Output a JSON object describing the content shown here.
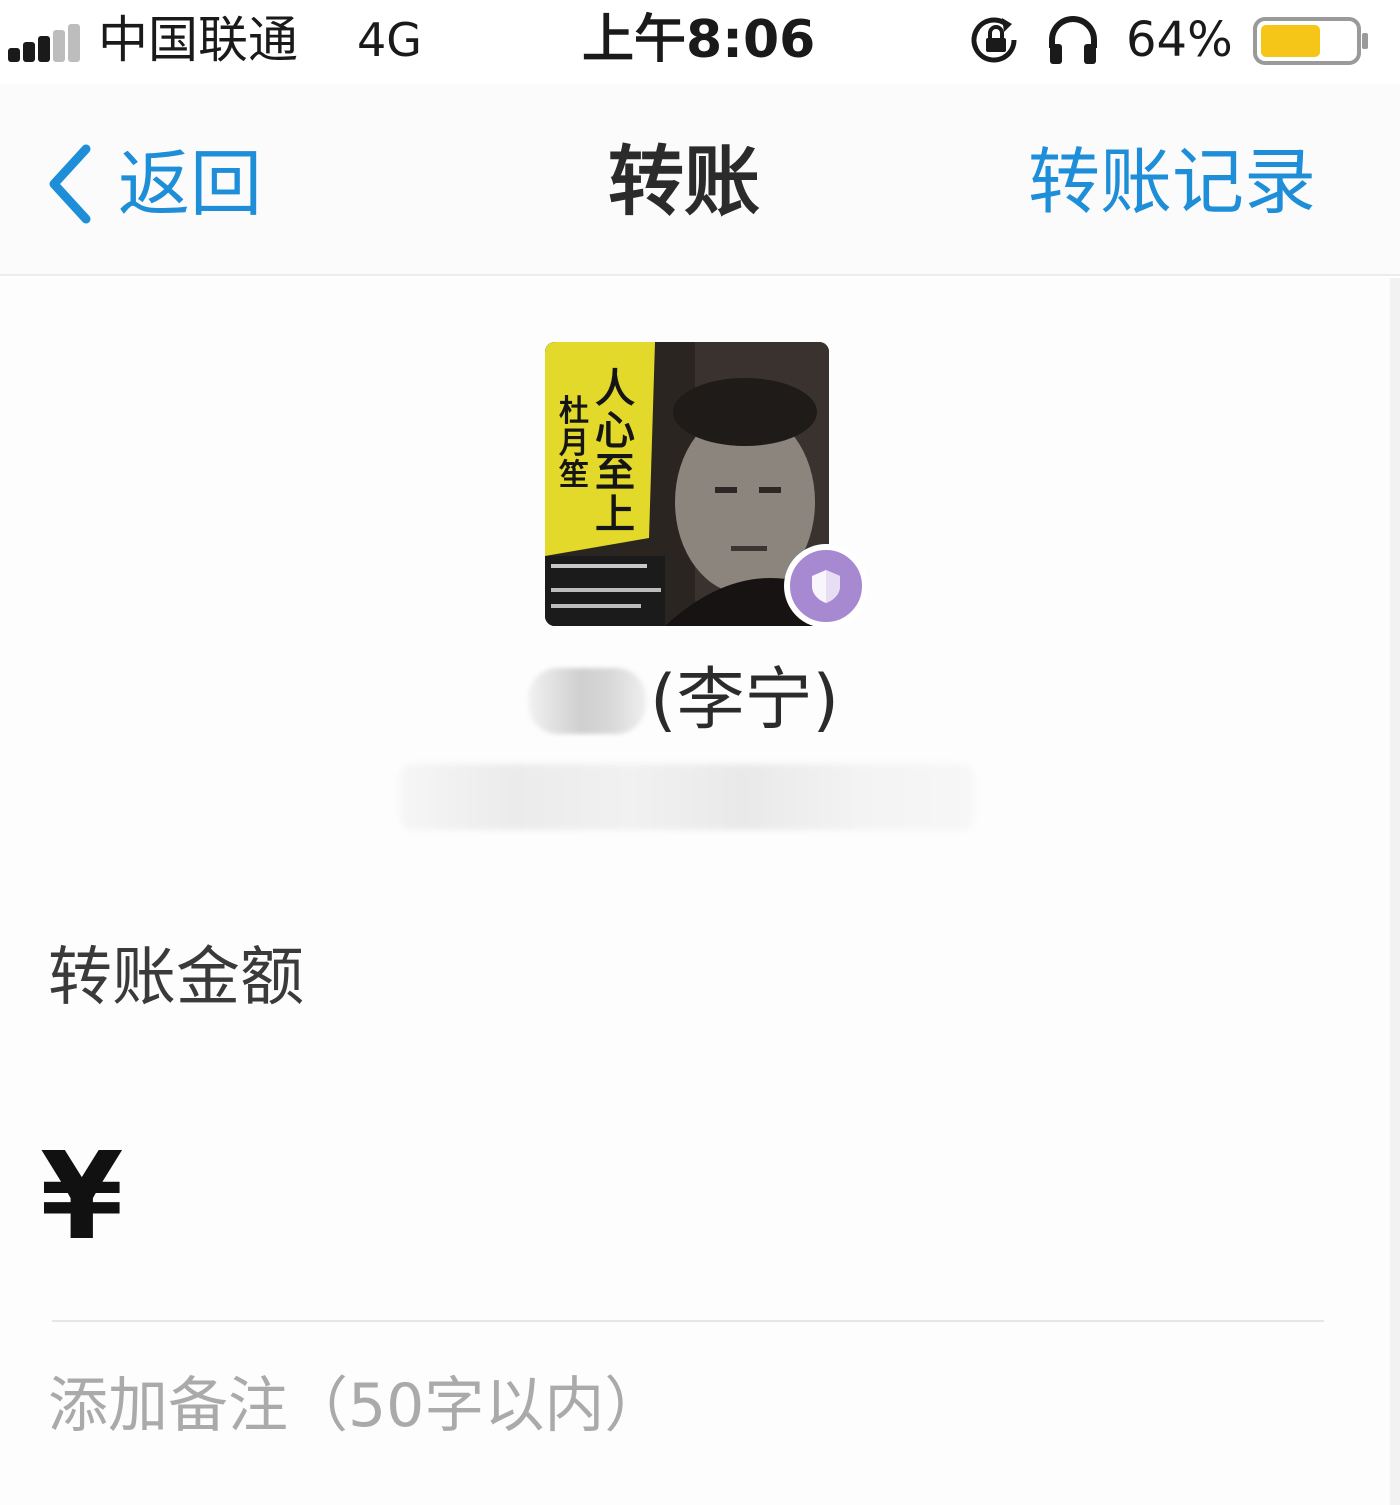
{
  "status_bar": {
    "carrier": "中国联通",
    "network": "4G",
    "time": "上午8:06",
    "battery_percent": "64%",
    "battery_level": 0.64,
    "signal_bars_filled": 3,
    "signal_bars_total": 5,
    "icons": [
      "signal-icon",
      "orientation-lock-icon",
      "headphones-icon",
      "battery-icon"
    ]
  },
  "nav": {
    "back_label": "返回",
    "title": "转账",
    "records_label": "转账记录",
    "accent_color": "#1e8ed8"
  },
  "recipient": {
    "name": "(李宁)",
    "avatar_text": {
      "title": "人心至上",
      "author": "杜月笙"
    },
    "badge_color": "#a689d0"
  },
  "form": {
    "amount_label": "转账金额",
    "currency_symbol": "¥",
    "amount_value": "",
    "note_placeholder": "添加备注（50字以内）",
    "note_value": ""
  }
}
